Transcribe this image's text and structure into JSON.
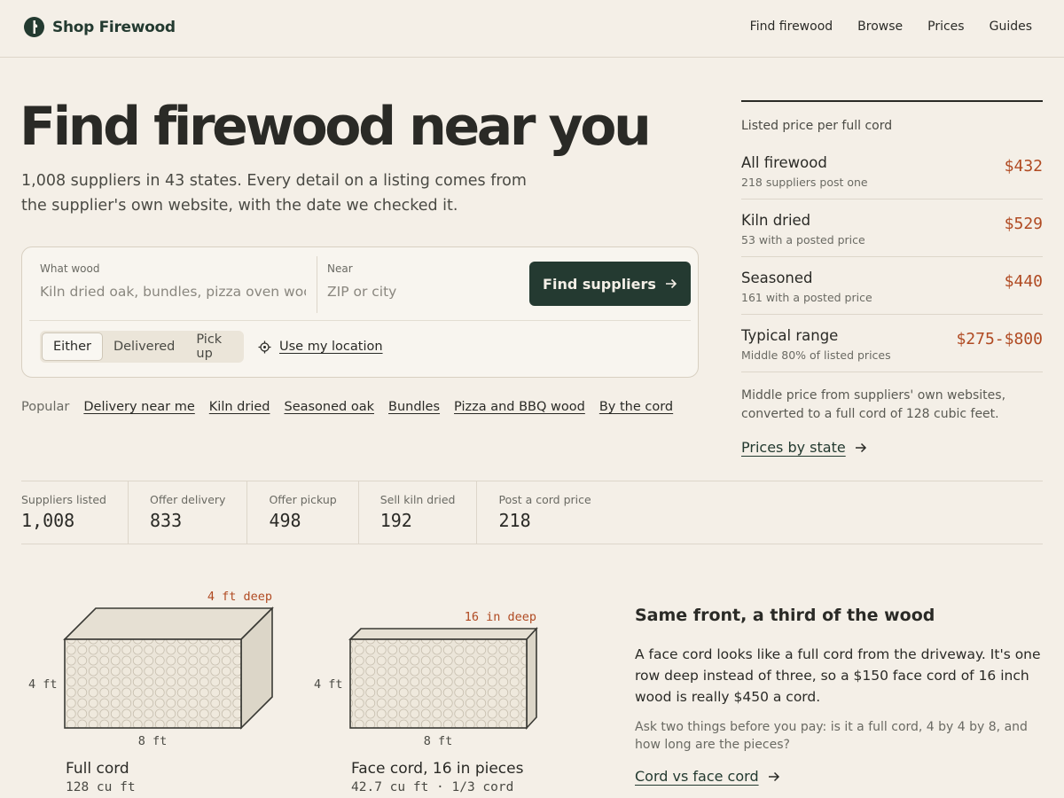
{
  "brand": {
    "name": "Shop Firewood"
  },
  "nav": {
    "items": [
      "Find firewood",
      "Browse",
      "Prices",
      "Guides"
    ]
  },
  "hero": {
    "title": "Find firewood near you",
    "subtitle": "1,008 suppliers in 43 states. Every detail on a listing comes from the supplier's own website, with the date we checked it."
  },
  "search": {
    "what_label": "What wood",
    "what_placeholder": "Kiln dried oak, bundles, pizza oven wood",
    "near_label": "Near",
    "near_placeholder": "ZIP or city",
    "submit_label": "Find suppliers",
    "modes": [
      "Either",
      "Delivered",
      "Pick up"
    ],
    "active_mode": "Either",
    "location_label": "Use my location"
  },
  "popular": {
    "label": "Popular",
    "links": [
      "Delivery near me",
      "Kiln dried",
      "Seasoned oak",
      "Bundles",
      "Pizza and BBQ wood",
      "By the cord"
    ]
  },
  "prices": {
    "heading": "Listed price per full cord",
    "rows": [
      {
        "name": "All firewood",
        "note": "218 suppliers post one",
        "value": "$432"
      },
      {
        "name": "Kiln dried",
        "note": "53 with a posted price",
        "value": "$529"
      },
      {
        "name": "Seasoned",
        "note": "161 with a posted price",
        "value": "$440"
      },
      {
        "name": "Typical range",
        "note": "Middle 80% of listed prices",
        "value": "$275-$800"
      }
    ],
    "footnote": "Middle price from suppliers' own websites, converted to a full cord of 128 cubic feet.",
    "link_label": "Prices by state"
  },
  "stats": [
    {
      "label": "Suppliers listed",
      "value": "1,008"
    },
    {
      "label": "Offer delivery",
      "value": "833"
    },
    {
      "label": "Offer pickup",
      "value": "498"
    },
    {
      "label": "Sell kiln dried",
      "value": "192"
    },
    {
      "label": "Post a cord price",
      "value": "218"
    }
  ],
  "cords": [
    {
      "title": "Full cord",
      "sub": "128 cu ft",
      "depth_label": "4 ft deep",
      "height_label": "4 ft",
      "width_label": "8 ft"
    },
    {
      "title": "Face cord, 16 in pieces",
      "sub": "42.7 cu ft · 1/3 cord",
      "depth_label": "16 in deep",
      "height_label": "4 ft",
      "width_label": "8 ft"
    }
  ],
  "explain": {
    "title": "Same front, a third of the wood",
    "body": "A face cord looks like a full cord from the driveway. It's one row deep instead of three, so a $150 face cord of 16 inch wood is really $450 a cord.",
    "note": "Ask two things before you pay: is it a full cord, 4 by 4 by 8, and how long are the pieces?",
    "link_label": "Cord vs face cord"
  },
  "colors": {
    "accent": "#243a31",
    "price": "#b04a22",
    "background": "#f4efe7"
  }
}
